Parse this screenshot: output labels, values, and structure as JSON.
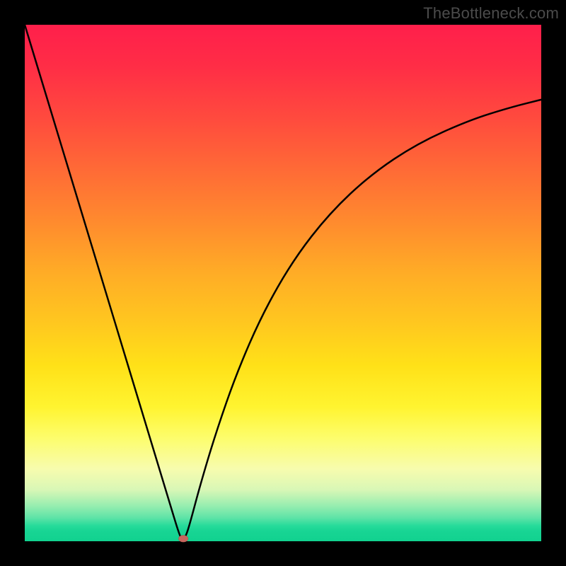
{
  "watermark": "TheBottleneck.com",
  "chart_data": {
    "type": "line",
    "title": "",
    "xlabel": "",
    "ylabel": "",
    "xlim": [
      0,
      1
    ],
    "ylim": [
      0,
      1
    ],
    "grid": false,
    "legend": false,
    "series": [
      {
        "name": "curve",
        "x": [
          0.0,
          0.05,
          0.1,
          0.15,
          0.2,
          0.25,
          0.28,
          0.3,
          0.305,
          0.307,
          0.312,
          0.32,
          0.34,
          0.37,
          0.41,
          0.46,
          0.52,
          0.59,
          0.67,
          0.76,
          0.86,
          0.94,
          1.0
        ],
        "y": [
          1.0,
          0.835,
          0.67,
          0.505,
          0.34,
          0.175,
          0.076,
          0.01,
          0.005,
          0.005,
          0.01,
          0.035,
          0.11,
          0.21,
          0.325,
          0.44,
          0.545,
          0.635,
          0.71,
          0.77,
          0.815,
          0.84,
          0.855
        ]
      }
    ],
    "marker": {
      "x": 0.307,
      "y": 0.005
    },
    "background_gradient_stops": [
      {
        "pos": 0.0,
        "color": "#ff1f4b"
      },
      {
        "pos": 0.48,
        "color": "#ffac26"
      },
      {
        "pos": 0.8,
        "color": "#fdfd6c"
      },
      {
        "pos": 1.0,
        "color": "#11d28f"
      }
    ]
  }
}
